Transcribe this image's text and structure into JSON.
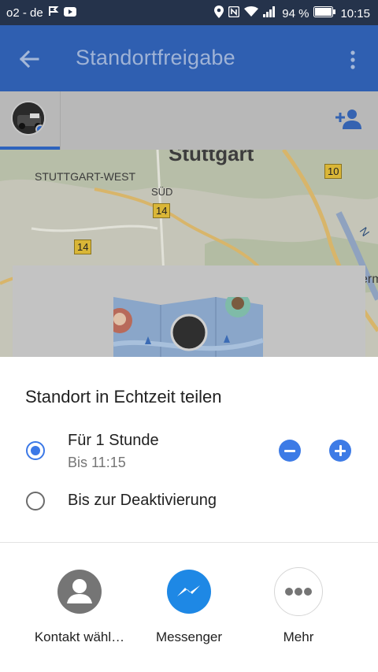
{
  "status_bar": {
    "carrier": "o2 - de",
    "battery": "94 %",
    "time": "10:15",
    "icons": [
      "flag-icon",
      "youtube-icon",
      "location-icon",
      "nfc-icon",
      "wifi-icon",
      "signal-icon",
      "battery-icon"
    ]
  },
  "app_bar": {
    "title": "Standortfreigabe",
    "back_icon": "arrow-back-icon",
    "menu_icon": "more-vert-icon"
  },
  "tabs": {
    "add_person_icon": "person-add-icon"
  },
  "map": {
    "city": "Stuttgart",
    "labels": {
      "west": "STUTTGART-WEST",
      "sued": "SÜD",
      "partial_right": "N",
      "partial_edge": "erm"
    },
    "road_shields": {
      "r1": "14",
      "r2": "14",
      "r3": "10"
    }
  },
  "sheet": {
    "title": "Standort in Echtzeit teilen",
    "option1_label": "Für 1 Stunde",
    "option1_sub": "Bis 11:15",
    "option2_label": "Bis zur Deaktivierung",
    "selected_option": 1,
    "share_targets": [
      {
        "label": "Kontakt wähl…",
        "icon": "contact-icon"
      },
      {
        "label": "Messenger",
        "icon": "messenger-icon"
      },
      {
        "label": "Mehr",
        "icon": "more-horiz-icon"
      }
    ]
  },
  "colors": {
    "app_bar": "#2f5fb1",
    "accent": "#3b78e7",
    "status_bar": "#25334b"
  }
}
